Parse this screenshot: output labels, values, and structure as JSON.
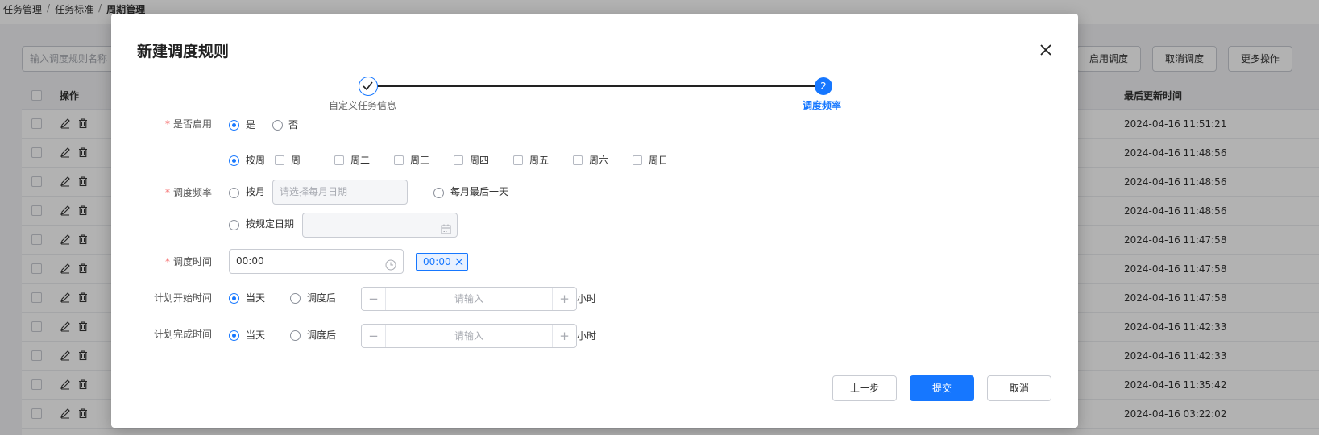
{
  "breadcrumb": {
    "items": [
      "任务管理",
      "任务标准",
      "周期管理"
    ],
    "separator": "/"
  },
  "toolbar": {
    "search_placeholder": "输入调度规则名称",
    "buttons": [
      "启用调度",
      "取消调度",
      "更多操作"
    ]
  },
  "table": {
    "columns": {
      "operation": "操作",
      "updated_at": "最后更新时间"
    },
    "rows": [
      "2024-04-16 11:51:21",
      "2024-04-16 11:48:56",
      "2024-04-16 11:48:56",
      "2024-04-16 11:48:56",
      "2024-04-16 11:47:58",
      "2024-04-16 11:47:58",
      "2024-04-16 11:47:58",
      "2024-04-16 11:42:33",
      "2024-04-16 11:42:33",
      "2024-04-16 11:35:42",
      "2024-04-16 03:22:02"
    ],
    "row_icons": [
      "edit-icon",
      "delete-icon"
    ]
  },
  "modal": {
    "title": "新建调度规则",
    "steps": [
      {
        "label": "自定义任务信息",
        "status": "done"
      },
      {
        "number": "2",
        "label": "调度频率",
        "status": "active"
      }
    ],
    "enable": {
      "label": "是否启用",
      "required": "*",
      "options": [
        "是",
        "否"
      ],
      "selected": "是"
    },
    "frequency": {
      "label": "调度频率",
      "required": "*",
      "weekly_label": "按周",
      "weekdays": [
        "周一",
        "周二",
        "周三",
        "周四",
        "周五",
        "周六",
        "周日"
      ],
      "monthly_label": "按月",
      "monthly_placeholder": "请选择每月日期",
      "month_last_day_label": "每月最后一天",
      "fixed_date_label": "按规定日期",
      "selected": "按周"
    },
    "schedule_time": {
      "label": "调度时间",
      "required": "*",
      "value": "00:00",
      "tag": "00:00"
    },
    "plan_start": {
      "label": "计划开始时间",
      "options": [
        "当天",
        "调度后"
      ],
      "selected": "当天",
      "placeholder": "请输入",
      "unit": "小时",
      "minus": "−",
      "plus": "+"
    },
    "plan_end": {
      "label": "计划完成时间",
      "options": [
        "当天",
        "调度后"
      ],
      "selected": "当天",
      "placeholder": "请输入",
      "unit": "小时",
      "minus": "−",
      "plus": "+"
    },
    "footer": {
      "prev": "上一步",
      "submit": "提交",
      "cancel": "取消"
    },
    "colors": {
      "primary": "#1677ff",
      "required": "#f56c6c"
    }
  }
}
